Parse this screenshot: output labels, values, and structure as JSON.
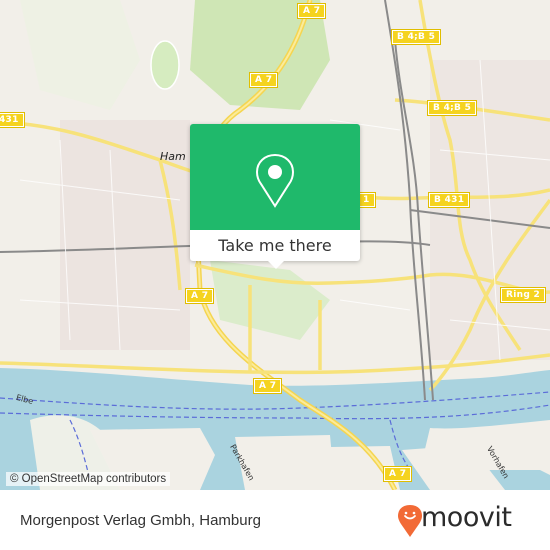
{
  "map": {
    "place_label": "Ham",
    "water_labels": {
      "river": "Elbe",
      "harbor_1": "Parkhafen",
      "harbor_2": "Vorhafen"
    },
    "road_shields": [
      {
        "id": "a7-top",
        "label": "A 7"
      },
      {
        "id": "a7-mid",
        "label": "A 7"
      },
      {
        "id": "a7-left",
        "label": "A 7"
      },
      {
        "id": "a7-elbe",
        "label": "A 7"
      },
      {
        "id": "a7-bottom",
        "label": "A 7"
      },
      {
        "id": "b4b5-top",
        "label": "B 4;B 5"
      },
      {
        "id": "b4b5-mid",
        "label": "B 4;B 5"
      },
      {
        "id": "b431",
        "label": "B 431"
      },
      {
        "id": "ring2",
        "label": "Ring 2"
      },
      {
        "id": "b431-left",
        "label": "431"
      },
      {
        "id": "b431-right-partial",
        "label": "1"
      }
    ],
    "colors": {
      "land": "#f2efe9",
      "water": "#aad3df",
      "park": "#cde8b0",
      "road": "#f7e27a",
      "rail": "#8a8a8a",
      "shipping": "#5b6cd8"
    }
  },
  "popup": {
    "icon": "location-pin-icon",
    "cta_label": "Take me there",
    "accent": "#1fb96b"
  },
  "attribution": "© OpenStreetMap contributors",
  "footer": {
    "title": "Morgenpost Verlag Gmbh, Hamburg",
    "logo_text": "moovit",
    "logo_color": "#f26a36"
  }
}
